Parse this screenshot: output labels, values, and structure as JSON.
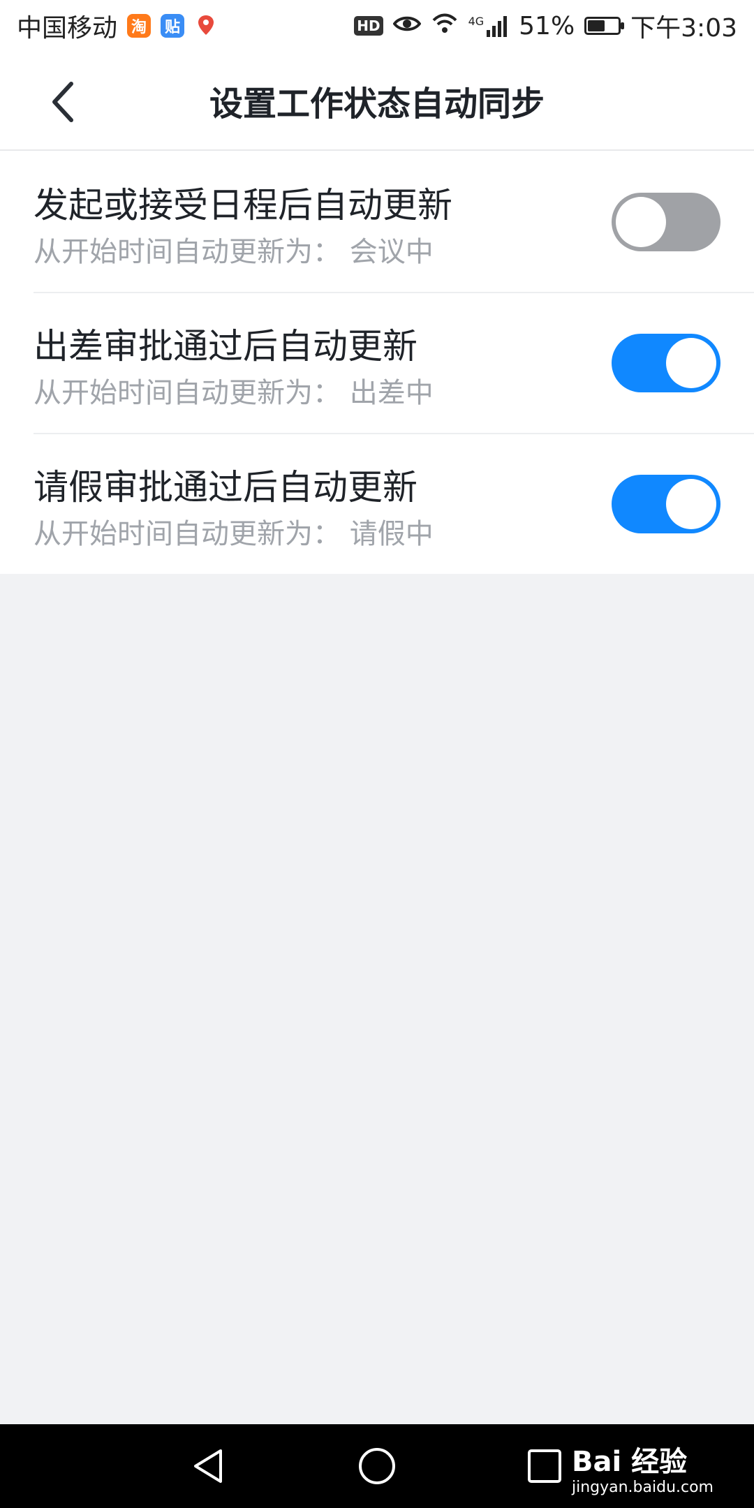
{
  "status_bar": {
    "carrier": "中国移动",
    "taobao_icon_text": "淘",
    "tieba_icon_text": "贴",
    "hd": "HD",
    "network": "4G",
    "battery": "51%",
    "battery_level": 0.51,
    "time": "下午3:03"
  },
  "nav": {
    "title": "设置工作状态自动同步"
  },
  "settings": [
    {
      "title": "发起或接受日程后自动更新",
      "subtitle": "从开始时间自动更新为：  会议中",
      "enabled": false
    },
    {
      "title": "出差审批通过后自动更新",
      "subtitle": "从开始时间自动更新为：  出差中",
      "enabled": true
    },
    {
      "title": "请假审批通过后自动更新",
      "subtitle": "从开始时间自动更新为：  请假中",
      "enabled": true
    }
  ],
  "watermark": {
    "brand": "Bai 经验",
    "url": "jingyan.baidu.com"
  },
  "colors": {
    "toggle_on": "#1088ff",
    "toggle_off": "#a0a2a6",
    "page_bg": "#f1f2f4"
  },
  "icons": [
    "back-arrow-icon",
    "eye-icon",
    "wifi-icon",
    "signal-icon",
    "battery-icon",
    "nav-back-icon",
    "nav-home-icon",
    "nav-recents-icon"
  ]
}
